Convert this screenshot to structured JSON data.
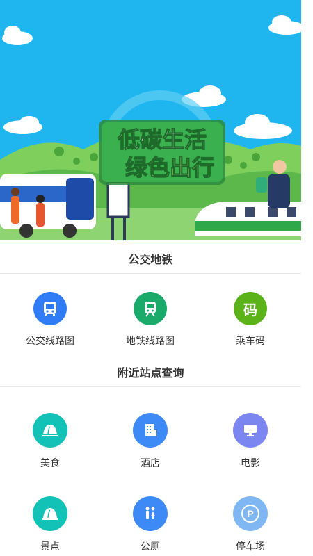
{
  "banner": {
    "headline_line1": "低碳生活",
    "headline_line2": "绿色出行",
    "sky_color": "#1fb6f0",
    "accent_green": "#2fa84a"
  },
  "transit": {
    "title": "公交地铁",
    "items": [
      {
        "label": "公交线路图",
        "icon": "bus-icon",
        "color": "#2f7cf6"
      },
      {
        "label": "地铁线路图",
        "icon": "subway-icon",
        "color": "#1aaa6a"
      },
      {
        "label": "乘车码",
        "icon": "ride-code-icon",
        "glyph": "码",
        "color": "#5bb319"
      }
    ]
  },
  "nearby": {
    "title": "附近站点查询",
    "items": [
      {
        "label": "美食",
        "icon": "food-icon",
        "color": "#13c2b7"
      },
      {
        "label": "酒店",
        "icon": "hotel-icon",
        "color": "#3d8af7"
      },
      {
        "label": "电影",
        "icon": "movie-icon",
        "color": "#7c86f0"
      },
      {
        "label": "景点",
        "icon": "scenic-spot-icon",
        "color": "#13c2b7"
      },
      {
        "label": "公厕",
        "icon": "restroom-icon",
        "color": "#3d8af7"
      },
      {
        "label": "停车场",
        "icon": "parking-icon",
        "glyph": "P",
        "color": "#7fb7f2"
      }
    ]
  }
}
